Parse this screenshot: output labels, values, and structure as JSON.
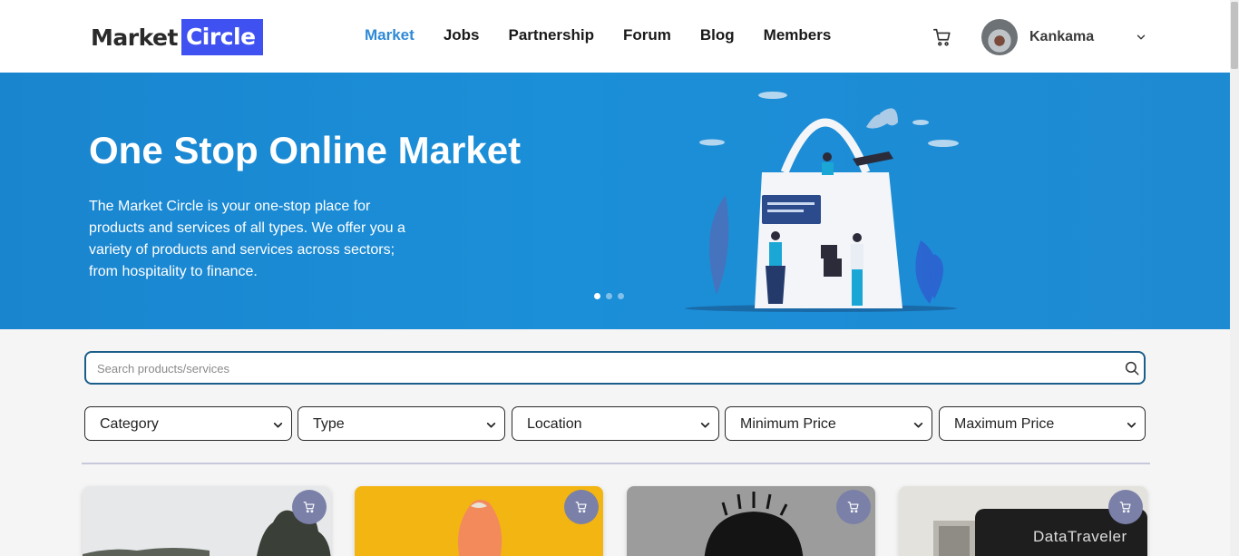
{
  "brand": {
    "word1": "Market",
    "word2": "Circle"
  },
  "nav": {
    "items": [
      {
        "label": "Market",
        "active": true
      },
      {
        "label": "Jobs"
      },
      {
        "label": "Partnership"
      },
      {
        "label": "Forum"
      },
      {
        "label": "Blog"
      },
      {
        "label": "Members"
      }
    ]
  },
  "user": {
    "name": "Kankama"
  },
  "hero": {
    "title": "One Stop Online Market",
    "description": "The Market Circle is your one-stop place for products and services of all types. We offer you a variety of products and services across sectors; from hospitality to finance.",
    "slides": 3,
    "active_slide": 1
  },
  "search": {
    "placeholder": "Search products/services",
    "value": ""
  },
  "filters": [
    {
      "label": "Category"
    },
    {
      "label": "Type"
    },
    {
      "label": "Location"
    },
    {
      "label": "Minimum Price"
    },
    {
      "label": "Maximum Price"
    }
  ],
  "products": [
    {
      "image": "outdoor-trees-photo"
    },
    {
      "image": "orange-item-on-yellow-photo"
    },
    {
      "image": "grayscale-portrait-photo"
    },
    {
      "image": "datatraveler-usb-drive-photo",
      "brand_text": "DataTraveler"
    }
  ],
  "colors": {
    "accent": "#2f8ad6",
    "hero": "#1b8fd8",
    "logo_box": "#3f51f0",
    "card_button": "#7a80a8"
  }
}
